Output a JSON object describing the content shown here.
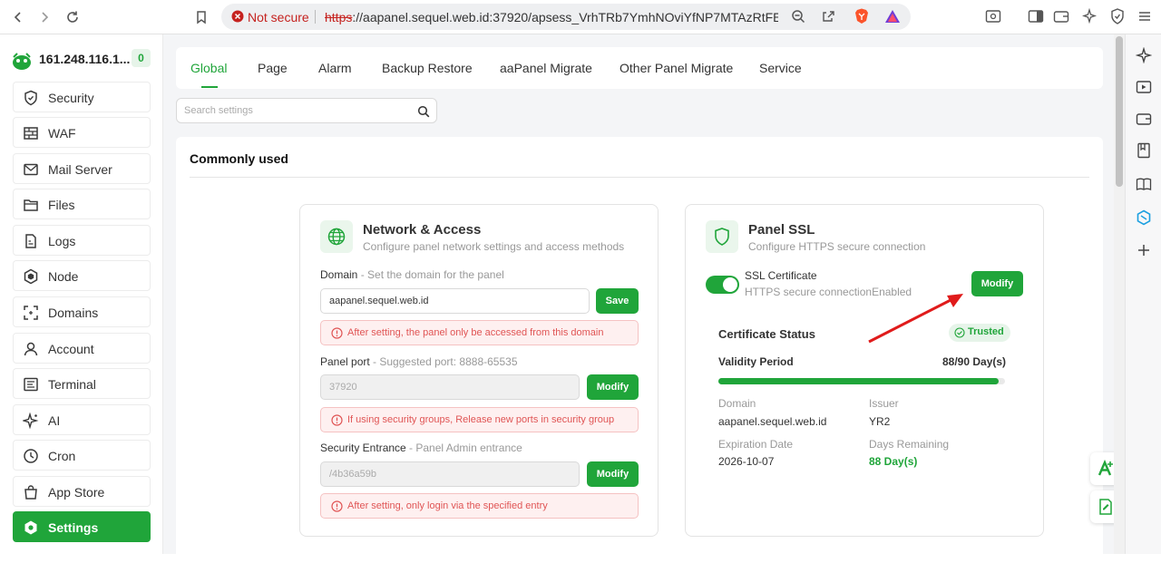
{
  "browser": {
    "security_label": "Not secure",
    "url_scheme": "https",
    "url_rest": "://aapanel.sequel.web.id:37920/apsess_VrhTRb7YmhNOviYfNP7MTAzRtFEk..."
  },
  "server": {
    "name": "161.248.116.1...",
    "badge": "0"
  },
  "sidebar": {
    "items": [
      {
        "label": "Security",
        "icon": "shield-icon"
      },
      {
        "label": "WAF",
        "icon": "firewall-icon"
      },
      {
        "label": "Mail Server",
        "icon": "mail-icon"
      },
      {
        "label": "Files",
        "icon": "folder-icon"
      },
      {
        "label": "Logs",
        "icon": "log-icon"
      },
      {
        "label": "Node",
        "icon": "node-icon"
      },
      {
        "label": "Domains",
        "icon": "domains-icon"
      },
      {
        "label": "Account",
        "icon": "user-icon"
      },
      {
        "label": "Terminal",
        "icon": "terminal-icon"
      },
      {
        "label": "AI",
        "icon": "sparkle-icon"
      },
      {
        "label": "Cron",
        "icon": "clock-icon"
      },
      {
        "label": "App Store",
        "icon": "store-icon"
      },
      {
        "label": "Settings",
        "icon": "gear-icon",
        "active": true
      }
    ]
  },
  "tabs": [
    "Global",
    "Page",
    "Alarm",
    "Backup Restore",
    "aaPanel Migrate",
    "Other Panel Migrate",
    "Service"
  ],
  "search": {
    "placeholder": "Search settings"
  },
  "section_title": "Commonly used",
  "network": {
    "title": "Network & Access",
    "subtitle": "Configure panel network settings and access methods",
    "domain_label": "Domain",
    "domain_hint": " - Set the domain for the panel",
    "domain_value": "aapanel.sequel.web.id",
    "domain_button": "Save",
    "domain_alert": "After setting, the panel only be accessed from this domain",
    "port_label": "Panel port",
    "port_hint": " - Suggested port: 8888-65535",
    "port_value": "37920",
    "port_button": "Modify",
    "port_alert": "If using security groups, Release new ports in security group",
    "entrance_label": "Security Entrance",
    "entrance_hint": " - Panel Admin entrance",
    "entrance_value": "/4b36a59b",
    "entrance_button": "Modify",
    "entrance_alert": "After setting, only login via the specified entry"
  },
  "ssl": {
    "title": "Panel SSL",
    "subtitle": "Configure HTTPS secure connection",
    "cert_label": "SSL Certificate",
    "cert_status_text": "HTTPS secure connectionEnabled",
    "toggle_on": true,
    "modify_button": "Modify",
    "status_label": "Certificate Status",
    "trusted_badge": "Trusted",
    "validity_label": "Validity Period",
    "validity_value": "88/90 Day(s)",
    "validity_progress": 0.978,
    "domain_label": "Domain",
    "domain_value": "aapanel.sequel.web.id",
    "issuer_label": "Issuer",
    "issuer_value": "YR2",
    "expiration_label": "Expiration Date",
    "expiration_value": "2026-10-07",
    "remaining_label": "Days Remaining",
    "remaining_value": "88 Day(s)"
  },
  "colors": {
    "accent": "#20a53a",
    "alert": "#e05555",
    "annotation_arrow": "#e01b1b"
  }
}
